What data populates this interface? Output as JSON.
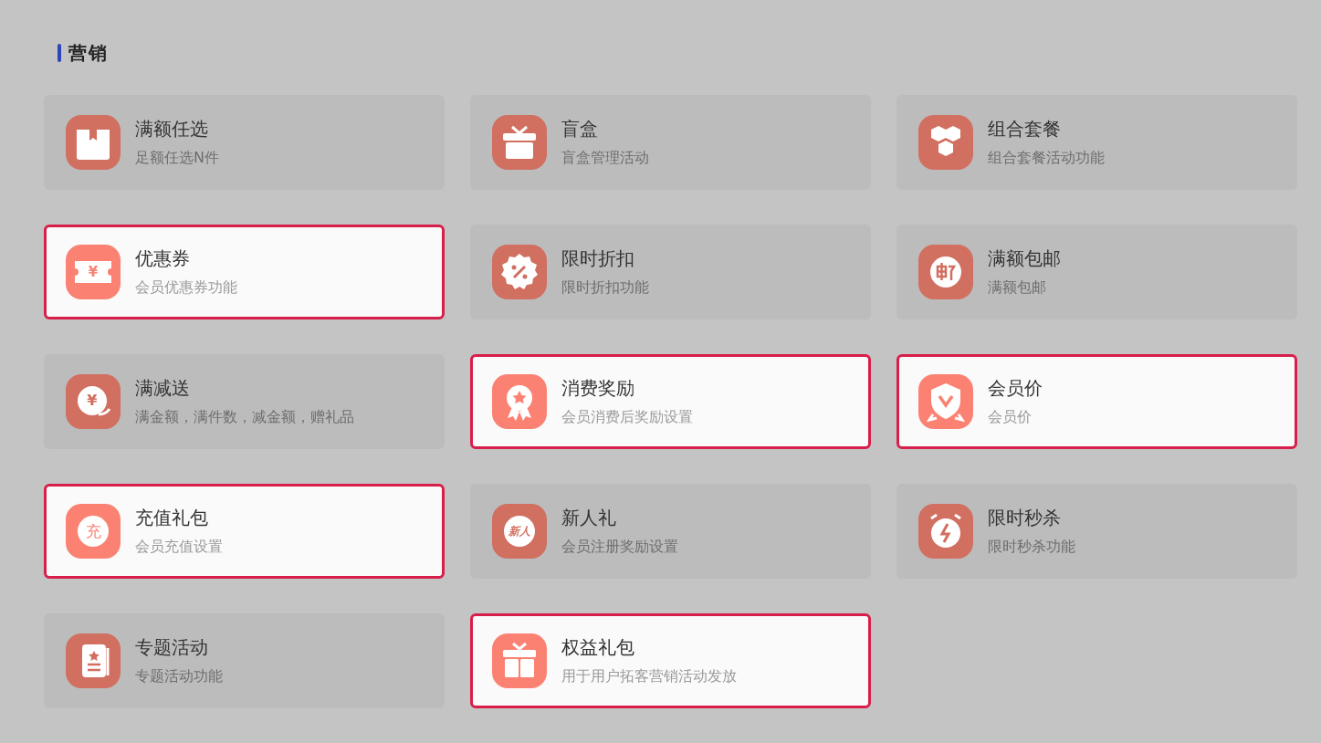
{
  "section": {
    "title": "营销"
  },
  "cards": [
    {
      "title": "满额任选",
      "subtitle": "足额任选N件",
      "highlighted": false,
      "icon": {
        "kind": "box"
      }
    },
    {
      "title": "盲盒",
      "subtitle": "盲盒管理活动",
      "highlighted": false,
      "icon": {
        "kind": "gift"
      }
    },
    {
      "title": "组合套餐",
      "subtitle": "组合套餐活动功能",
      "highlighted": false,
      "icon": {
        "kind": "hexagons"
      }
    },
    {
      "title": "优惠券",
      "subtitle": "会员优惠券功能",
      "highlighted": true,
      "icon": {
        "kind": "coupon",
        "glyph": "¥"
      }
    },
    {
      "title": "限时折扣",
      "subtitle": "限时折扣功能",
      "highlighted": false,
      "icon": {
        "kind": "discount"
      }
    },
    {
      "title": "满额包邮",
      "subtitle": "满额包邮",
      "highlighted": false,
      "icon": {
        "kind": "stamp"
      }
    },
    {
      "title": "满减送",
      "subtitle": "满金额，满件数，减金额，赠礼品",
      "highlighted": false,
      "icon": {
        "kind": "coin",
        "glyph": "¥"
      }
    },
    {
      "title": "消费奖励",
      "subtitle": "会员消费后奖励设置",
      "highlighted": true,
      "icon": {
        "kind": "medal"
      }
    },
    {
      "title": "会员价",
      "subtitle": "会员价",
      "highlighted": true,
      "icon": {
        "kind": "shield"
      }
    },
    {
      "title": "充值礼包",
      "subtitle": "会员充值设置",
      "highlighted": true,
      "icon": {
        "kind": "circle-text",
        "glyph": "充"
      }
    },
    {
      "title": "新人礼",
      "subtitle": "会员注册奖励设置",
      "highlighted": false,
      "icon": {
        "kind": "circle-text",
        "glyph": "新人"
      }
    },
    {
      "title": "限时秒杀",
      "subtitle": "限时秒杀功能",
      "highlighted": false,
      "icon": {
        "kind": "alarm"
      }
    },
    {
      "title": "专题活动",
      "subtitle": "专题活动功能",
      "highlighted": false,
      "icon": {
        "kind": "document"
      }
    },
    {
      "title": "权益礼包",
      "subtitle": "用于用户拓客营销活动发放",
      "highlighted": true,
      "icon": {
        "kind": "giftbox"
      }
    }
  ]
}
